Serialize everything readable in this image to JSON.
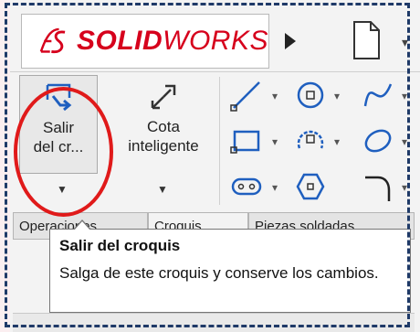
{
  "logo": {
    "brand_bold": "SOLID",
    "brand_thin": "WORKS"
  },
  "ribbon": {
    "exit_sketch": {
      "line1": "Salir",
      "line2": "del cr..."
    },
    "smart_dimension": {
      "line1": "Cota",
      "line2": "inteligente"
    }
  },
  "tabs": {
    "first": "Operaciones",
    "second": "Croquis",
    "third": "Piezas soldadas"
  },
  "tooltip": {
    "title": "Salir del croquis",
    "body": "Salga de este croquis y conserve los cambios."
  },
  "colors": {
    "brand_red": "#d6001c",
    "highlight_oval": "#e01a1a",
    "frame_dash": "#1f3a68",
    "icon_blue": "#1f5fbf"
  }
}
